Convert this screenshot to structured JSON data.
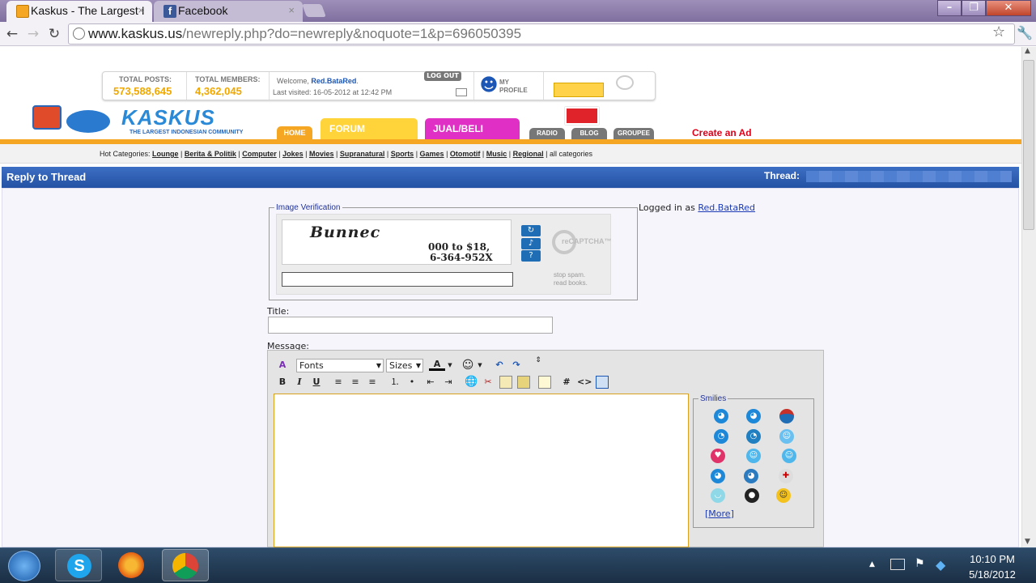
{
  "browser": {
    "tabs": [
      {
        "label": "Kaskus - The Largest I",
        "close": "×"
      },
      {
        "label": "Facebook",
        "close": "×"
      }
    ],
    "url_host": "www.kaskus.us",
    "url_path": "/newreply.php?do=newreply&noquote=1&p=696050395",
    "window_buttons": {
      "minimize": "–",
      "maximize": "❐",
      "close": "✕"
    }
  },
  "header": {
    "total_posts_label": "TOTAL POSTS:",
    "total_posts_value": "573,588,645",
    "total_members_label": "TOTAL MEMBERS:",
    "total_members_value": "4,362,045",
    "welcome_prefix": "Welcome,",
    "username": "Red.BataRed",
    "last_visited": "Last visited: 16-05-2012 at 12:42 PM",
    "logout": "LOG OUT",
    "my_profile": "MY PROFILE",
    "logo_text": "KASKUS",
    "logo_tagline": "THE LARGEST INDONESIAN COMMUNITY",
    "nav": {
      "home": "HOME",
      "forum": "FORUM",
      "jualbeli": "JUAL/BELI",
      "radio": "RADIO",
      "blog": "BLOG",
      "groupee": "GROUPEE"
    },
    "create_ad": "Create an Ad"
  },
  "hot_categories": {
    "label": "Hot Categories:",
    "items": [
      "Lounge",
      "Berita & Politik",
      "Computer",
      "Jokes",
      "Movies",
      "Supranatural",
      "Sports",
      "Games",
      "Otomotif",
      "Music",
      "Regional"
    ],
    "all": "all categories"
  },
  "reply": {
    "heading": "Reply to Thread",
    "thread_label": "Thread:",
    "image_verification": "Image Verification",
    "captcha_text_1": "Bunnec",
    "captcha_text_2": "000 to $18,",
    "captcha_text_3": "6-364-952X",
    "recaptcha_brand": "reCAPTCHA™",
    "recaptcha_slogan_1": "stop spam.",
    "recaptcha_slogan_2": "read books.",
    "logged_in_as": "Logged in as",
    "title_label": "Title:",
    "message_label": "Message:",
    "fonts": "Fonts",
    "sizes": "Sizes",
    "smilies_legend": "Smilies",
    "more": "More"
  },
  "taskbar": {
    "time": "10:10 PM",
    "date": "5/18/2012"
  },
  "colors": {
    "accent_orange": "#f5a623",
    "reply_blue": "#2451a3",
    "create_ad_red": "#e0001a"
  }
}
